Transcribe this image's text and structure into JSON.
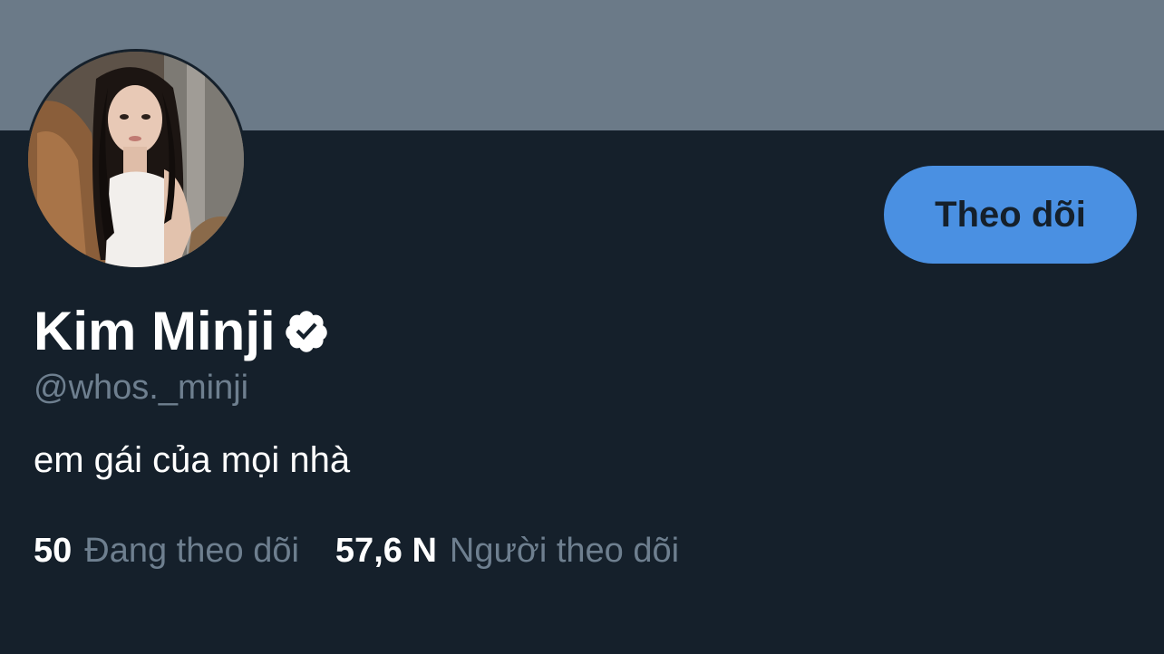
{
  "profile": {
    "display_name": "Kim Minji",
    "handle": "@whos._minji",
    "bio": "em gái của mọi nhà",
    "verified": true,
    "verified_icon": "verified-badge-icon",
    "avatar": "profile-photo"
  },
  "actions": {
    "follow_label": "Theo dõi"
  },
  "stats": {
    "following_count": "50",
    "following_label": "Đang theo dõi",
    "followers_count": "57,6 N",
    "followers_label": "Người theo dõi"
  },
  "colors": {
    "background": "#15202b",
    "banner": "#6b7a88",
    "accent": "#4a90e2",
    "muted_text": "#6e7f8f",
    "primary_text": "#ffffff"
  }
}
